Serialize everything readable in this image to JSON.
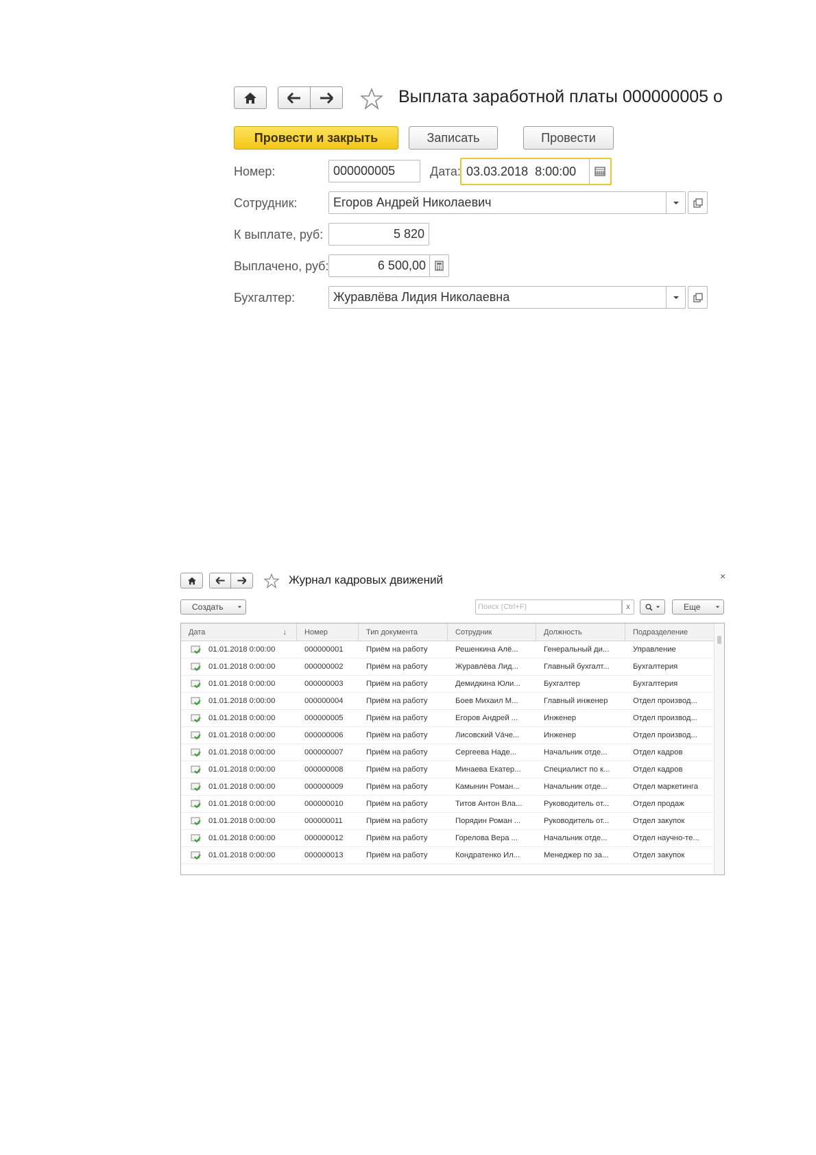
{
  "form1": {
    "title": "Выплата заработной платы 000000005 о",
    "buttons": {
      "post_close": "Провести и закрыть",
      "save": "Записать",
      "post": "Провести"
    },
    "fields": {
      "number_label": "Номер:",
      "number_value": "000000005",
      "date_label": "Дата:",
      "date_value": "03.03.2018  8:00:00",
      "employee_label": "Сотрудник:",
      "employee_value": "Егоров Андрей Николаевич",
      "to_pay_label": "К выплате, руб:",
      "to_pay_value": "5 820",
      "paid_label": "Выплачено, руб:",
      "paid_value": "6 500,00",
      "accountant_label": "Бухгалтер:",
      "accountant_value": "Журавлёва Лидия Николаевна"
    }
  },
  "form2": {
    "title": "Журнал кадровых движений",
    "close": "×",
    "create_label": "Создать",
    "search_placeholder": "Поиск (Ctrl+F)",
    "search_clear": "x",
    "more_label": "Еще",
    "columns": [
      "Дата",
      "Номер",
      "Тип документа",
      "Сотрудник",
      "Должность",
      "Подразделение"
    ],
    "sort_indicator": "↓",
    "rows": [
      [
        "01.01.2018 0:00:00",
        "000000001",
        "Приём на работу",
        "Решенкина Алё...",
        "Генеральный ди...",
        "Управление"
      ],
      [
        "01.01.2018 0:00:00",
        "000000002",
        "Приём на работу",
        "Журавлёва Лид...",
        "Главный бухгалт...",
        "Бухгалтерия"
      ],
      [
        "01.01.2018 0:00:00",
        "000000003",
        "Приём на работу",
        "Демидкина Юли...",
        "Бухгалтер",
        "Бухгалтерия"
      ],
      [
        "01.01.2018 0:00:00",
        "000000004",
        "Приём на работу",
        "Боев Михаил М...",
        "Главный инженер",
        "Отдел производ..."
      ],
      [
        "01.01.2018 0:00:00",
        "000000005",
        "Приём на работу",
        "Егоров Андрей ...",
        "Инженер",
        "Отдел производ..."
      ],
      [
        "01.01.2018 0:00:00",
        "000000006",
        "Приём на работу",
        "Лисовский Váче...",
        "Инженер",
        "Отдел производ..."
      ],
      [
        "01.01.2018 0:00:00",
        "000000007",
        "Приём на работу",
        "Сергеева Наде...",
        "Начальник отде...",
        "Отдел кадров"
      ],
      [
        "01.01.2018 0:00:00",
        "000000008",
        "Приём на работу",
        "Минаева Екатер...",
        "Специалист по к...",
        "Отдел кадров"
      ],
      [
        "01.01.2018 0:00:00",
        "000000009",
        "Приём на работу",
        "Камынин Роман...",
        "Начальник отде...",
        "Отдел маркетинга"
      ],
      [
        "01.01.2018 0:00:00",
        "000000010",
        "Приём на работу",
        "Титов Антон Вла...",
        "Руководитель от...",
        "Отдел продаж"
      ],
      [
        "01.01.2018 0:00:00",
        "000000011",
        "Приём на работу",
        "Порядин Роман ...",
        "Руководитель от...",
        "Отдел закупок"
      ],
      [
        "01.01.2018 0:00:00",
        "000000012",
        "Приём на работу",
        "Горелова Вера ...",
        "Начальник отде...",
        "Отдел научно-те..."
      ],
      [
        "01.01.2018 0:00:00",
        "000000013",
        "Приём на работу",
        "Кондратенко Ил...",
        "Менеджер по за...",
        "Отдел закупок"
      ]
    ]
  }
}
